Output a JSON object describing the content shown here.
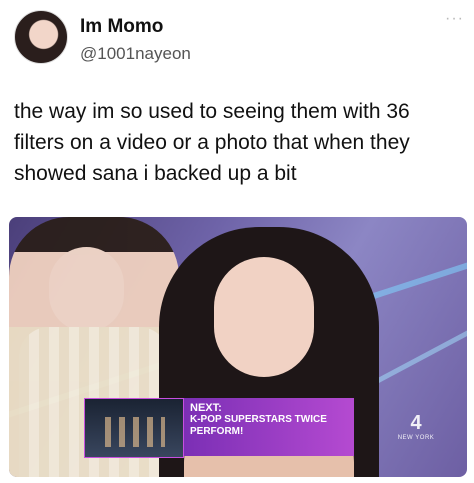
{
  "post": {
    "display_name": "Im Momo",
    "handle": "@1001nayeon",
    "more_glyph": "···",
    "text": "the way im so used to seeing them with 36 filters on a video or a photo that when they showed sana i backed up a bit"
  },
  "media": {
    "next_label": "NEXT:",
    "next_title": "K-POP SUPERSTARS TWICE PERFORM!",
    "logo_number": "4",
    "logo_city": "NEW YORK"
  },
  "colors": {
    "accent_purple": "#9b3fd0",
    "stage_light": "#7fd6ff"
  },
  "icons": {
    "more": "more-dots-icon",
    "avatar": "profile-avatar"
  }
}
